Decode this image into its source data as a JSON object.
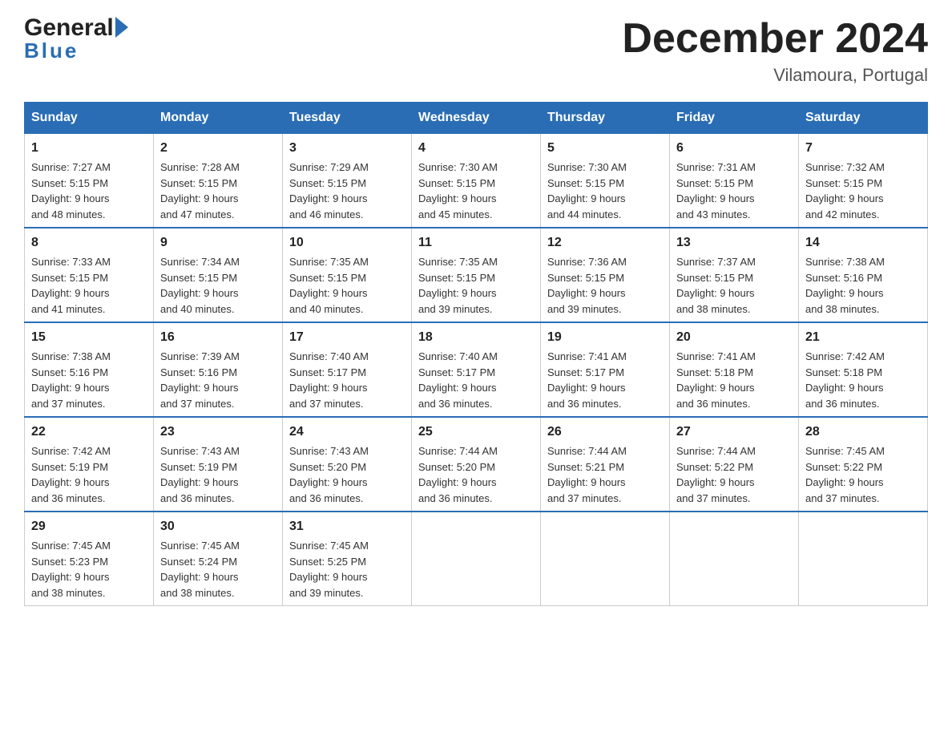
{
  "header": {
    "logo_line1": "General",
    "logo_line2": "Blue",
    "title": "December 2024",
    "location": "Vilamoura, Portugal"
  },
  "days_of_week": [
    "Sunday",
    "Monday",
    "Tuesday",
    "Wednesday",
    "Thursday",
    "Friday",
    "Saturday"
  ],
  "weeks": [
    [
      {
        "day": "1",
        "sunrise": "7:27 AM",
        "sunset": "5:15 PM",
        "daylight": "9 hours and 48 minutes."
      },
      {
        "day": "2",
        "sunrise": "7:28 AM",
        "sunset": "5:15 PM",
        "daylight": "9 hours and 47 minutes."
      },
      {
        "day": "3",
        "sunrise": "7:29 AM",
        "sunset": "5:15 PM",
        "daylight": "9 hours and 46 minutes."
      },
      {
        "day": "4",
        "sunrise": "7:30 AM",
        "sunset": "5:15 PM",
        "daylight": "9 hours and 45 minutes."
      },
      {
        "day": "5",
        "sunrise": "7:30 AM",
        "sunset": "5:15 PM",
        "daylight": "9 hours and 44 minutes."
      },
      {
        "day": "6",
        "sunrise": "7:31 AM",
        "sunset": "5:15 PM",
        "daylight": "9 hours and 43 minutes."
      },
      {
        "day": "7",
        "sunrise": "7:32 AM",
        "sunset": "5:15 PM",
        "daylight": "9 hours and 42 minutes."
      }
    ],
    [
      {
        "day": "8",
        "sunrise": "7:33 AM",
        "sunset": "5:15 PM",
        "daylight": "9 hours and 41 minutes."
      },
      {
        "day": "9",
        "sunrise": "7:34 AM",
        "sunset": "5:15 PM",
        "daylight": "9 hours and 40 minutes."
      },
      {
        "day": "10",
        "sunrise": "7:35 AM",
        "sunset": "5:15 PM",
        "daylight": "9 hours and 40 minutes."
      },
      {
        "day": "11",
        "sunrise": "7:35 AM",
        "sunset": "5:15 PM",
        "daylight": "9 hours and 39 minutes."
      },
      {
        "day": "12",
        "sunrise": "7:36 AM",
        "sunset": "5:15 PM",
        "daylight": "9 hours and 39 minutes."
      },
      {
        "day": "13",
        "sunrise": "7:37 AM",
        "sunset": "5:15 PM",
        "daylight": "9 hours and 38 minutes."
      },
      {
        "day": "14",
        "sunrise": "7:38 AM",
        "sunset": "5:16 PM",
        "daylight": "9 hours and 38 minutes."
      }
    ],
    [
      {
        "day": "15",
        "sunrise": "7:38 AM",
        "sunset": "5:16 PM",
        "daylight": "9 hours and 37 minutes."
      },
      {
        "day": "16",
        "sunrise": "7:39 AM",
        "sunset": "5:16 PM",
        "daylight": "9 hours and 37 minutes."
      },
      {
        "day": "17",
        "sunrise": "7:40 AM",
        "sunset": "5:17 PM",
        "daylight": "9 hours and 37 minutes."
      },
      {
        "day": "18",
        "sunrise": "7:40 AM",
        "sunset": "5:17 PM",
        "daylight": "9 hours and 36 minutes."
      },
      {
        "day": "19",
        "sunrise": "7:41 AM",
        "sunset": "5:17 PM",
        "daylight": "9 hours and 36 minutes."
      },
      {
        "day": "20",
        "sunrise": "7:41 AM",
        "sunset": "5:18 PM",
        "daylight": "9 hours and 36 minutes."
      },
      {
        "day": "21",
        "sunrise": "7:42 AM",
        "sunset": "5:18 PM",
        "daylight": "9 hours and 36 minutes."
      }
    ],
    [
      {
        "day": "22",
        "sunrise": "7:42 AM",
        "sunset": "5:19 PM",
        "daylight": "9 hours and 36 minutes."
      },
      {
        "day": "23",
        "sunrise": "7:43 AM",
        "sunset": "5:19 PM",
        "daylight": "9 hours and 36 minutes."
      },
      {
        "day": "24",
        "sunrise": "7:43 AM",
        "sunset": "5:20 PM",
        "daylight": "9 hours and 36 minutes."
      },
      {
        "day": "25",
        "sunrise": "7:44 AM",
        "sunset": "5:20 PM",
        "daylight": "9 hours and 36 minutes."
      },
      {
        "day": "26",
        "sunrise": "7:44 AM",
        "sunset": "5:21 PM",
        "daylight": "9 hours and 37 minutes."
      },
      {
        "day": "27",
        "sunrise": "7:44 AM",
        "sunset": "5:22 PM",
        "daylight": "9 hours and 37 minutes."
      },
      {
        "day": "28",
        "sunrise": "7:45 AM",
        "sunset": "5:22 PM",
        "daylight": "9 hours and 37 minutes."
      }
    ],
    [
      {
        "day": "29",
        "sunrise": "7:45 AM",
        "sunset": "5:23 PM",
        "daylight": "9 hours and 38 minutes."
      },
      {
        "day": "30",
        "sunrise": "7:45 AM",
        "sunset": "5:24 PM",
        "daylight": "9 hours and 38 minutes."
      },
      {
        "day": "31",
        "sunrise": "7:45 AM",
        "sunset": "5:25 PM",
        "daylight": "9 hours and 39 minutes."
      },
      null,
      null,
      null,
      null
    ]
  ],
  "labels": {
    "sunrise": "Sunrise:",
    "sunset": "Sunset:",
    "daylight": "Daylight:"
  }
}
